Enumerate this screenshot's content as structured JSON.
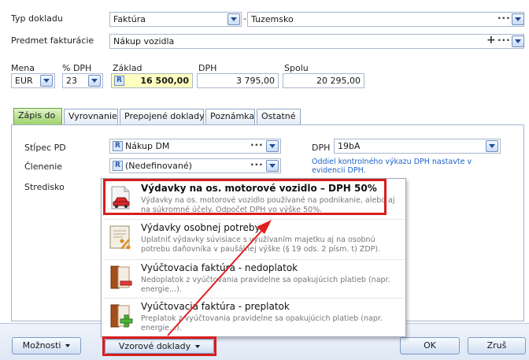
{
  "form": {
    "typ_dokladu_label": "Typ dokladu",
    "typ_dokladu_value": "Faktúra",
    "typ_dokladu_separator": "-",
    "tuzemsko_value": "Tuzemsko",
    "predmet_label": "Predmet fakturácie",
    "predmet_value": "Nákup vozidla",
    "plus_symbol": "+",
    "mena_label": "Mena",
    "mena_value": "EUR",
    "dph_pct_label": "% DPH",
    "dph_pct_value": "23",
    "zaklad_label": "Základ",
    "zaklad_value": "16 500,00",
    "dph_label": "DPH",
    "dph_value": "3 795,00",
    "spolu_label": "Spolu",
    "spolu_value": "20 295,00",
    "r_badge": "R",
    "dots": "···"
  },
  "tabs": [
    {
      "label": "Zápis do"
    },
    {
      "label": "Vyrovnanie"
    },
    {
      "label": "Prepojené doklady"
    },
    {
      "label": "Poznámka"
    },
    {
      "label": "Ostatné"
    }
  ],
  "panel": {
    "stlpec_label": "Stĺpec PD",
    "stlpec_value": "Nákup DM",
    "clenenie_label": "Členenie",
    "clenenie_value": "(Nedefinované)",
    "stredisko_label": "Stredisko",
    "dph_label": "DPH",
    "dph_value": "19bA",
    "dph_note": "Oddiel kontrolného výkazu DPH nastavte v evidencii DPH."
  },
  "menu": {
    "items": [
      {
        "title": "Výdavky na os. motorové vozidlo – DPH 50%",
        "desc": "Výdavky na os. motorové vozidlo používané na podnikanie, alebo aj na súkromné účely. Odpočet DPH vo výške 50%.",
        "icon": "car-icon"
      },
      {
        "title": "Výdavky osobnej potreby",
        "desc": "Uplatniť výdavky súvisiace s využívaním majetku aj na osobnú potrebu daňovníka v paušálnej výške (§ 19 ods. 2 písm. t) ZDP).",
        "icon": "percent-document-icon"
      },
      {
        "title": "Vyúčtovacia faktúra - nedoplatok",
        "desc": "Nedoplatok z vyúčtovania pravidelne sa opakujúcich platieb (napr. energie...).",
        "icon": "binder-minus-icon"
      },
      {
        "title": "Vyúčtovacia faktúra - preplatok",
        "desc": "Preplatok z vyúčtovania pravidelne sa opakujúcich platieb (napr. energie...).",
        "icon": "binder-plus-icon"
      }
    ]
  },
  "bottom": {
    "moznosti_label": "Možnosti",
    "vzorove_label": "Vzorové doklady",
    "ok_label": "OK",
    "zrus_label": "Zruš"
  },
  "colors": {
    "highlight": "#d81e1e",
    "active_tab": "#9ed36a",
    "zaklad_bg": "#ffffc0"
  }
}
